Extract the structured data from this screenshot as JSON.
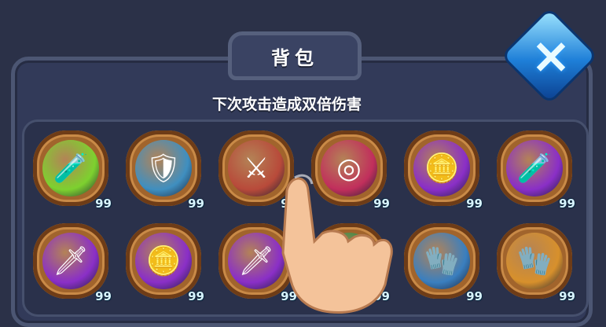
{
  "title": "背包",
  "subtitle": "下次攻击造成双倍伤害",
  "colors": {
    "panel": "#323a59",
    "rim": "#a1642c",
    "count_text": "#d8f4ff"
  },
  "items": [
    {
      "name": "red-potion-icon",
      "count": "99",
      "bg": "#7dd12f",
      "glyph": "🧪"
    },
    {
      "name": "shield-icon",
      "count": "99",
      "bg": "#3f8fc0",
      "glyph": "🛡"
    },
    {
      "name": "crossed-swords-icon",
      "count": "99",
      "bg": "#b84a3a",
      "glyph": "⚔"
    },
    {
      "name": "target-icon",
      "count": "99",
      "bg": "#c12f5c",
      "glyph": "◎"
    },
    {
      "name": "gold-coin-icon",
      "count": "99",
      "bg": "#8a2fc7",
      "glyph": "🪙"
    },
    {
      "name": "potion-boost-icon",
      "count": "99",
      "bg": "#8a2fc7",
      "glyph": "🧪"
    },
    {
      "name": "broken-sword-icon",
      "count": "99",
      "bg": "#8a2fc7",
      "glyph": "🗡"
    },
    {
      "name": "gold-coin-icon",
      "count": "99",
      "bg": "#8a2fc7",
      "glyph": "🪙"
    },
    {
      "name": "sword-coin-icon",
      "count": "99",
      "bg": "#8a2fc7",
      "glyph": "🗡"
    },
    {
      "name": "armor-glove-icon",
      "count": "99",
      "bg": "#2f8d45",
      "glyph": "🧤"
    },
    {
      "name": "armor-glove-icon",
      "count": "99",
      "bg": "#3a7fbf",
      "glyph": "🧤"
    },
    {
      "name": "golden-glove-icon",
      "count": "99",
      "bg": "#d7902c",
      "glyph": "🧤"
    }
  ]
}
